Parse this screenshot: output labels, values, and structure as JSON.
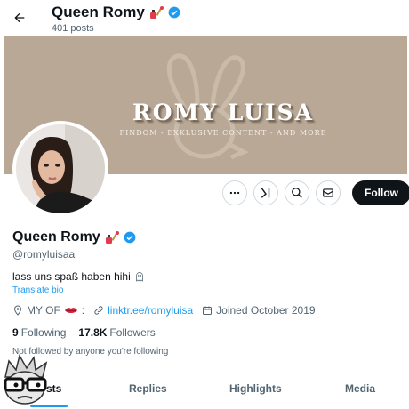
{
  "header": {
    "name": "Queen Romy",
    "posts_count": "401",
    "posts_label": "posts"
  },
  "banner": {
    "title": "ROMY LUISA",
    "subtitle": "FINDOM - EXKLUSIVE CONTENT - AND MORE"
  },
  "actions": {
    "follow_label": "Follow",
    "icons": [
      "more-icon",
      "grok-icon",
      "search-icon",
      "message-icon"
    ]
  },
  "profile": {
    "name": "Queen Romy",
    "handle": "@romyluisaa",
    "bio": "lass uns spaß haben hihi",
    "translate_label": "Translate bio",
    "location": "MY OF",
    "link": "linktr.ee/romyluisa",
    "joined": "Joined October 2019",
    "following_count": "9",
    "following_label": "Following",
    "followers_count": "17.8K",
    "followers_label": "Followers",
    "not_followed": "Not followed by anyone you're following"
  },
  "tabs": [
    {
      "label": "Posts",
      "visible_label": "sts",
      "active": true
    },
    {
      "label": "Replies",
      "active": false
    },
    {
      "label": "Highlights",
      "active": false
    },
    {
      "label": "Media",
      "active": false
    }
  ],
  "colors": {
    "accent": "#1d9bf0",
    "banner": "#b9a895",
    "text": "#0f1419",
    "muted": "#536471"
  }
}
